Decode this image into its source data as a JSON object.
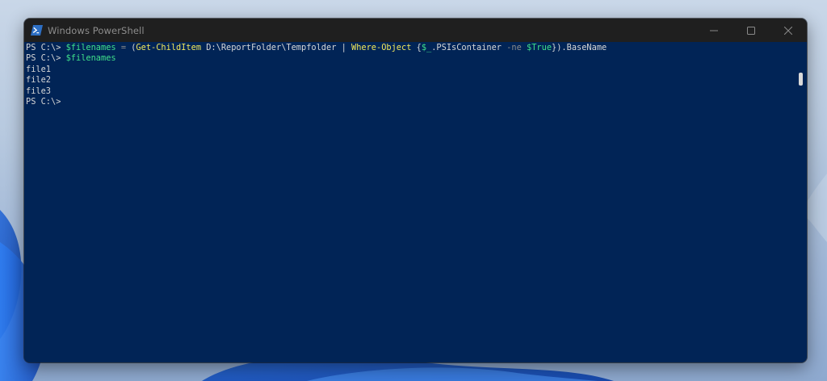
{
  "window": {
    "title": "Windows PowerShell",
    "icon": "powershell-icon",
    "controls": [
      "minimize-icon",
      "maximize-icon",
      "close-icon"
    ]
  },
  "console": {
    "lines": [
      [
        {
          "t": "PS C:\\> ",
          "c": "plain"
        },
        {
          "t": "$filenames",
          "c": "var"
        },
        {
          "t": " ",
          "c": "plain"
        },
        {
          "t": "=",
          "c": "op"
        },
        {
          "t": " (",
          "c": "plain"
        },
        {
          "t": "Get-ChildItem",
          "c": "cmd"
        },
        {
          "t": " D:\\ReportFolder\\Tempfolder | ",
          "c": "plain"
        },
        {
          "t": "Where-Object",
          "c": "cmd"
        },
        {
          "t": " {",
          "c": "plain"
        },
        {
          "t": "$_",
          "c": "var"
        },
        {
          "t": ".PSIsContainer ",
          "c": "plain"
        },
        {
          "t": "-ne",
          "c": "param"
        },
        {
          "t": " ",
          "c": "plain"
        },
        {
          "t": "$True",
          "c": "bool"
        },
        {
          "t": "}).BaseName",
          "c": "plain"
        }
      ],
      [
        {
          "t": "PS C:\\> ",
          "c": "plain"
        },
        {
          "t": "$filenames",
          "c": "var"
        }
      ],
      [
        {
          "t": "file1",
          "c": "plain"
        }
      ],
      [
        {
          "t": "file2",
          "c": "plain"
        }
      ],
      [
        {
          "t": "file3",
          "c": "plain"
        }
      ],
      [
        {
          "t": "PS C:\\>",
          "c": "plain"
        }
      ]
    ]
  },
  "colors": {
    "console_background": "#012456",
    "titlebar_background": "#1f1f1f",
    "text": "#d6d6d6",
    "variable": "#3fe08a",
    "cmdlet": "#f2e65a",
    "operator": "#8a8a8a"
  }
}
